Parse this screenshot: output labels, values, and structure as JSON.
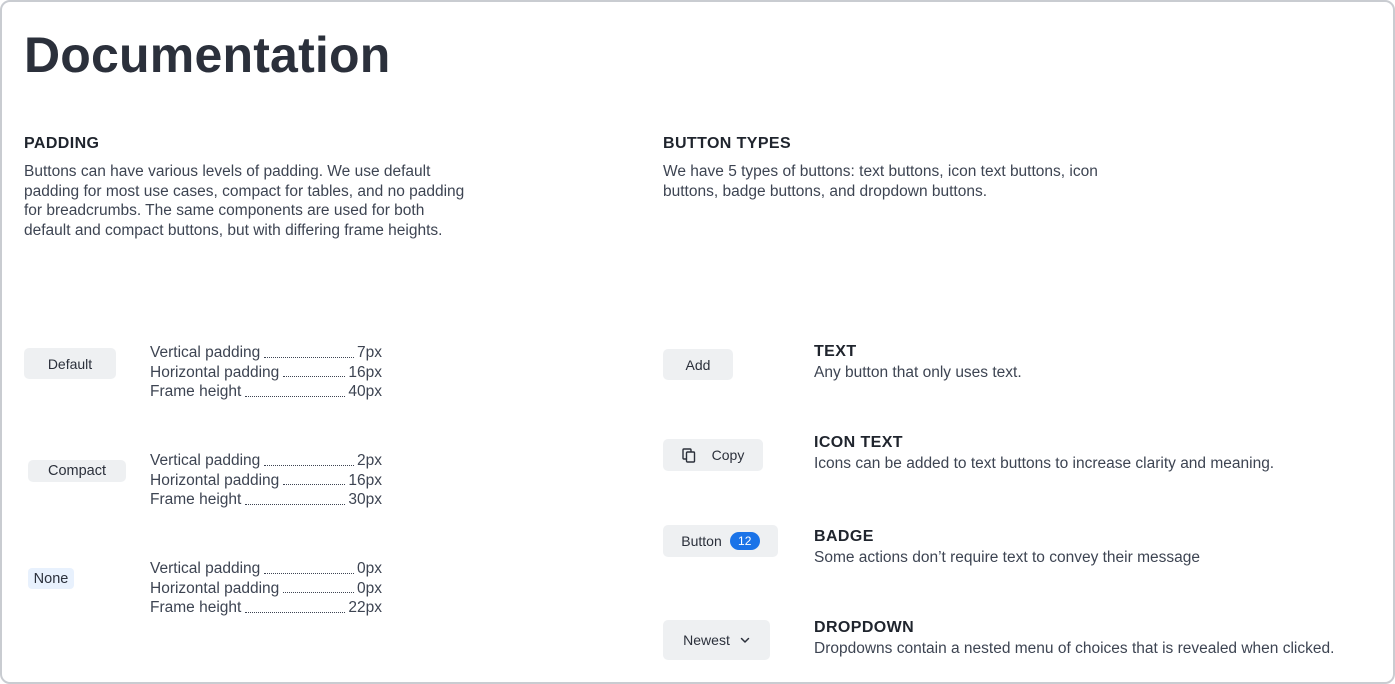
{
  "page": {
    "title": "Documentation"
  },
  "padding": {
    "heading": "PADDING",
    "description_lines": [
      "Buttons can have various levels of padding. We use default",
      "padding for most use cases, compact for tables, and no padding",
      "for breadcrumbs. The same components are used for both",
      "default and compact buttons, but with differing frame heights."
    ],
    "variants": [
      {
        "button_label": "Default",
        "specs": [
          {
            "label": "Vertical padding",
            "value": "7px"
          },
          {
            "label": "Horizontal padding",
            "value": "16px"
          },
          {
            "label": "Frame height",
            "value": "40px"
          }
        ]
      },
      {
        "button_label": "Compact",
        "specs": [
          {
            "label": "Vertical padding",
            "value": "2px"
          },
          {
            "label": "Horizontal padding",
            "value": "16px"
          },
          {
            "label": "Frame height",
            "value": "30px"
          }
        ]
      },
      {
        "button_label": "None",
        "specs": [
          {
            "label": "Vertical padding",
            "value": "0px"
          },
          {
            "label": "Horizontal padding",
            "value": "0px"
          },
          {
            "label": "Frame height",
            "value": "22px"
          }
        ]
      }
    ]
  },
  "button_types": {
    "heading": "BUTTON TYPES",
    "description_lines": [
      "We have 5 types of buttons: text buttons, icon text buttons, icon",
      "buttons, badge buttons, and dropdown buttons."
    ],
    "types": [
      {
        "title": "TEXT",
        "description": "Any button that only uses text.",
        "button_label": "Add"
      },
      {
        "title": "ICON TEXT",
        "description": "Icons can be added to text buttons to increase clarity and meaning.",
        "button_label": "Copy",
        "icon": "copy-icon"
      },
      {
        "title": "BADGE",
        "description": "Some actions don’t require text to convey their message",
        "button_label": "Button",
        "badge_count": "12",
        "badge_color": "#1a73e8"
      },
      {
        "title": "DROPDOWN",
        "description": "Dropdowns contain a nested menu of choices that is revealed when clicked.",
        "button_label": "Newest",
        "icon": "chevron-down-icon"
      }
    ]
  }
}
